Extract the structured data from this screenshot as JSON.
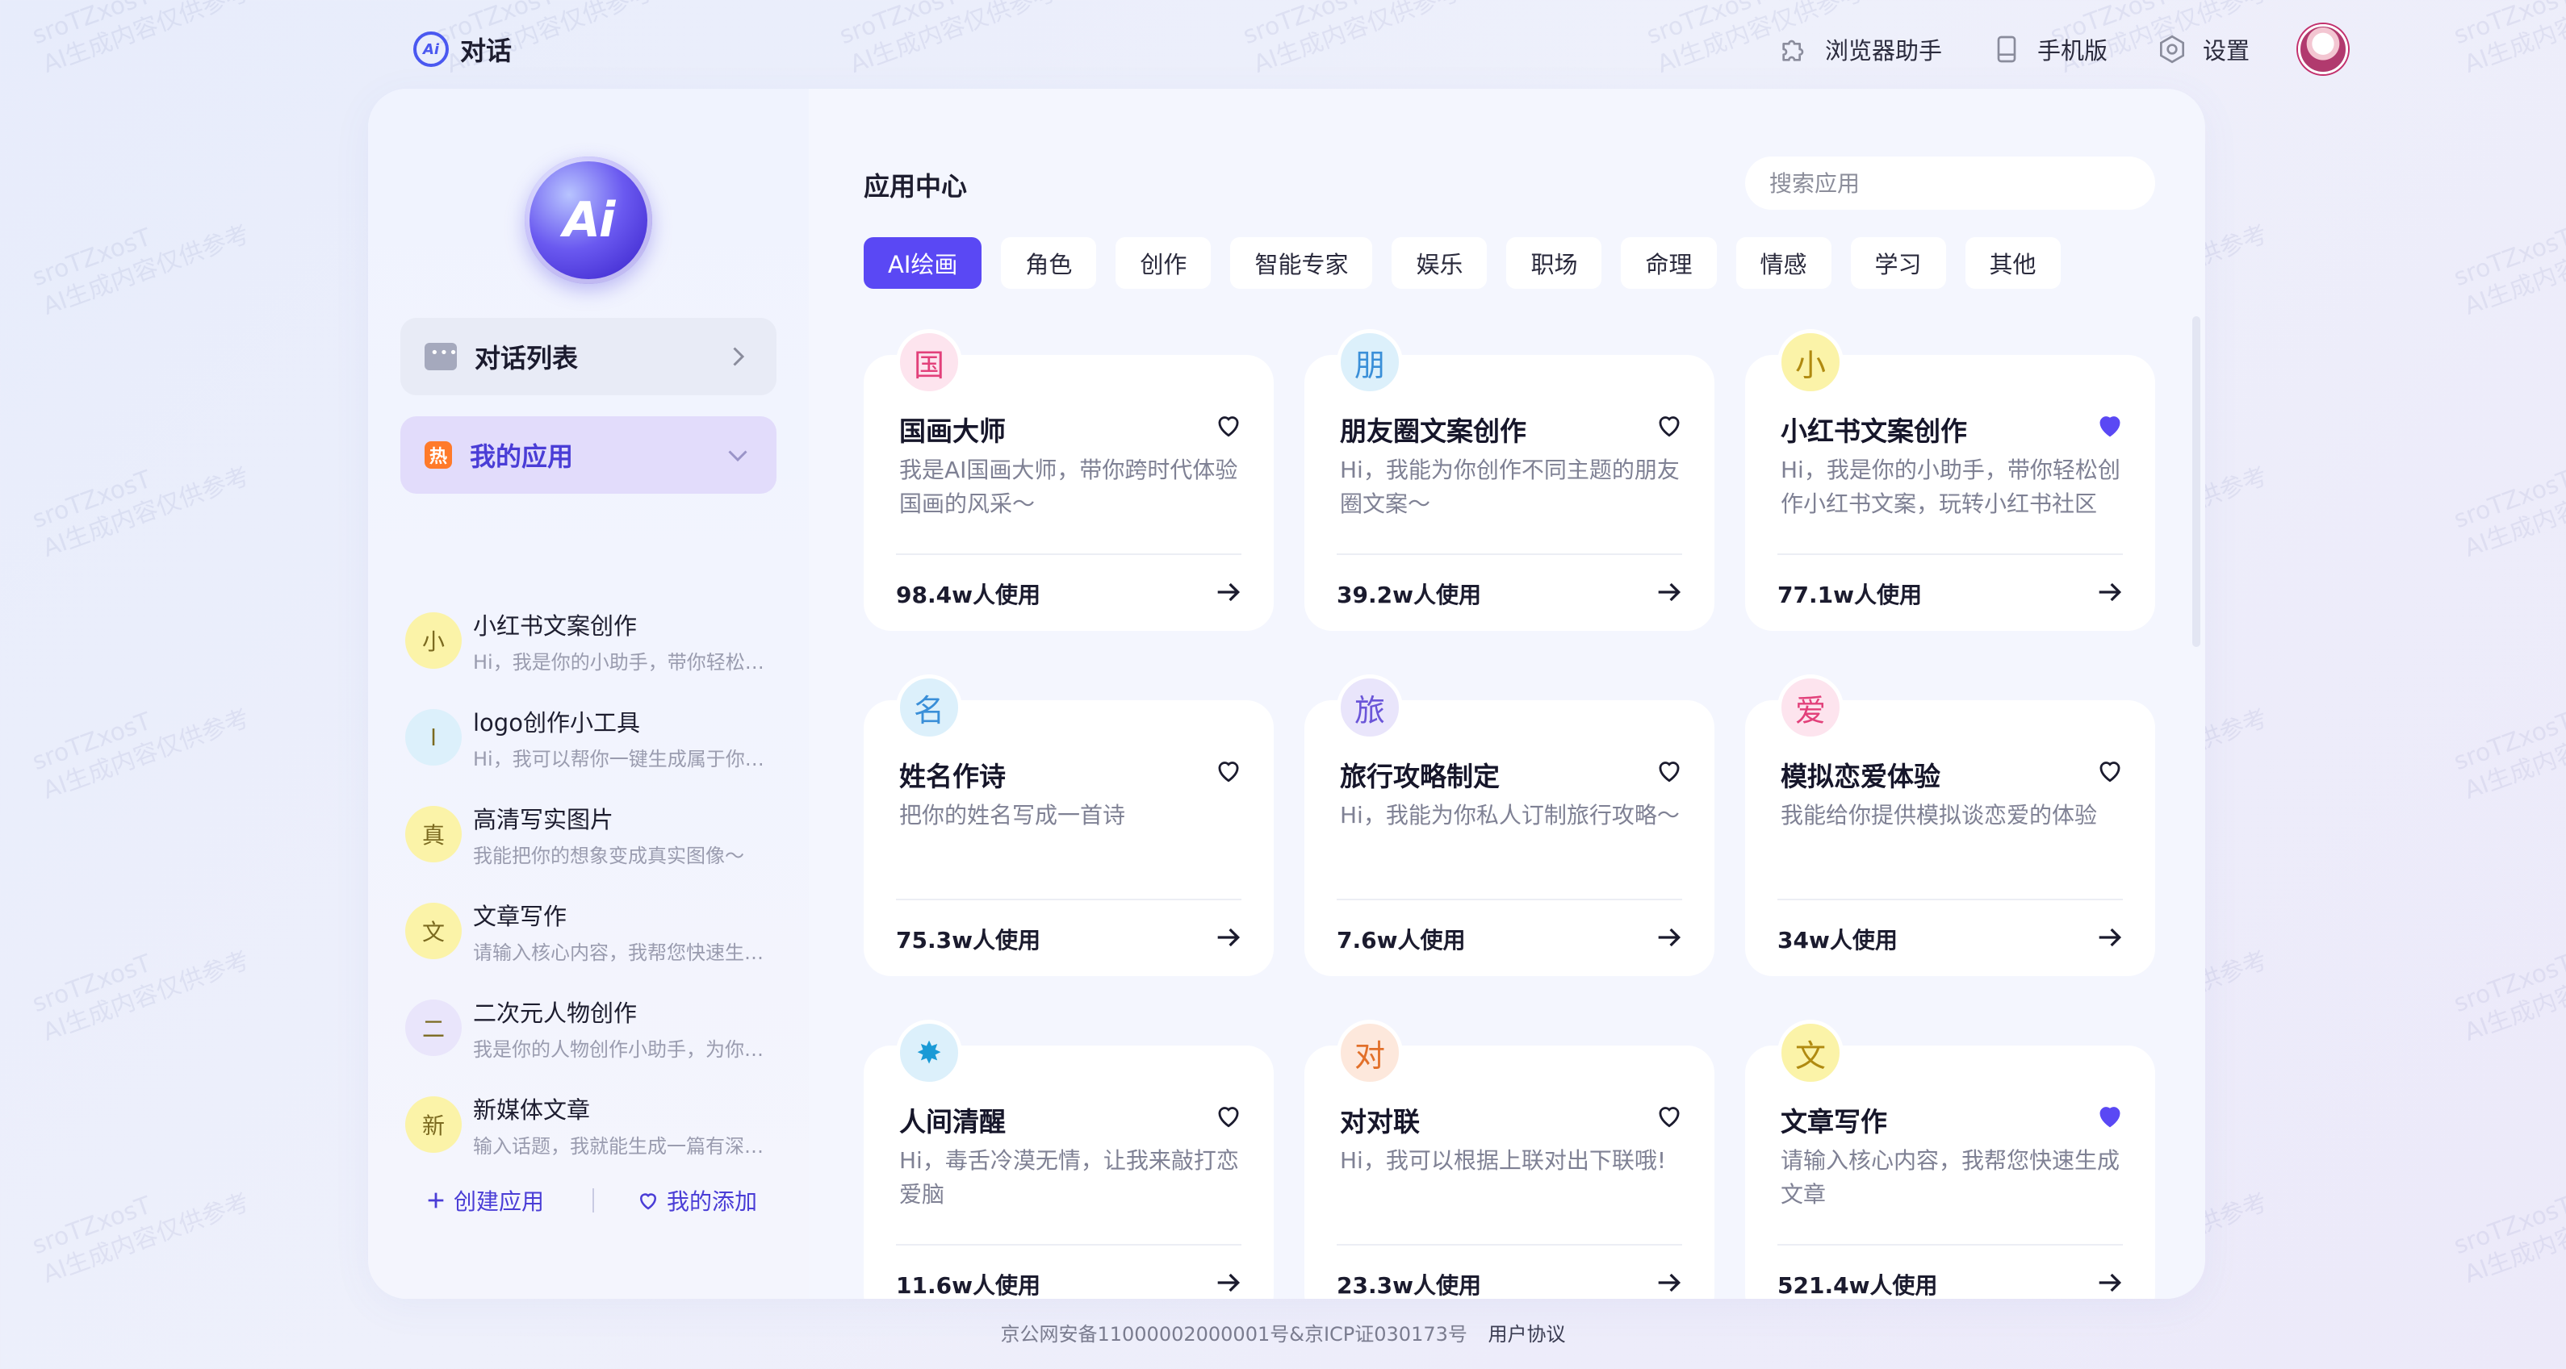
{
  "brand": {
    "title": "对话",
    "badge": "Ai"
  },
  "top_actions": [
    {
      "label": "浏览器助手",
      "icon": "puzzle-icon"
    },
    {
      "label": "手机版",
      "icon": "phone-icon"
    },
    {
      "label": "设置",
      "icon": "gear-icon"
    }
  ],
  "sidebar": {
    "logo": "Ai",
    "conversation_list": "对话列表",
    "my_apps": {
      "badge": "热",
      "label": "我的应用"
    },
    "apps": [
      {
        "avatar": "小",
        "title": "小红书文案创作",
        "desc": "Hi，我是你的小助手，带你轻松创作小红书文案",
        "color": "#fbf3a8"
      },
      {
        "avatar": "l",
        "title": "logo创作小工具",
        "desc": "Hi，我可以帮你一键生成属于你的logo",
        "color": "#dcf0fb"
      },
      {
        "avatar": "真",
        "title": "高清写实图片",
        "desc": "我能把你的想象变成真实图像～",
        "color": "#fbf3a8"
      },
      {
        "avatar": "文",
        "title": "文章写作",
        "desc": "请输入核心内容，我帮您快速生成文章",
        "color": "#fbf3a8"
      },
      {
        "avatar": "二",
        "title": "二次元人物创作",
        "desc": "我是你的人物创作小助手，为你生成二次元人物",
        "color": "#e9e5fb"
      },
      {
        "avatar": "新",
        "title": "新媒体文章",
        "desc": "输入话题，我就能生成一篇有深度的新媒体文章",
        "color": "#fbf3a8"
      }
    ],
    "create_app": "创建应用",
    "my_favorites": "我的添加"
  },
  "content": {
    "title": "应用中心",
    "search_placeholder": "搜索应用",
    "tabs": [
      "AI绘画",
      "角色",
      "创作",
      "智能专家",
      "娱乐",
      "职场",
      "命理",
      "情感",
      "学习",
      "其他"
    ],
    "active_tab": 0,
    "cards": [
      {
        "badge": "国",
        "badge_bg": "#fde4ee",
        "badge_color": "#e2407a",
        "name": "国画大师",
        "desc": "我是AI国画大师，带你跨时代体验国画的风采～",
        "uses": "98.4w人使用",
        "favorited": false
      },
      {
        "badge": "朋",
        "badge_bg": "#dcf0fb",
        "badge_color": "#3a8fd8",
        "name": "朋友圈文案创作",
        "desc": "Hi，我能为你创作不同主题的朋友圈文案～",
        "uses": "39.2w人使用",
        "favorited": false
      },
      {
        "badge": "小",
        "badge_bg": "#fbf3a8",
        "badge_color": "#b08a10",
        "name": "小红书文案创作",
        "desc": "Hi，我是你的小助手，带你轻松创作小红书文案，玩转小红书社区",
        "uses": "77.1w人使用",
        "favorited": true
      },
      {
        "badge": "名",
        "badge_bg": "#dcf0fb",
        "badge_color": "#3a8fd8",
        "name": "姓名作诗",
        "desc": "把你的姓名写成一首诗",
        "uses": "75.3w人使用",
        "favorited": false
      },
      {
        "badge": "旅",
        "badge_bg": "#e9e5fb",
        "badge_color": "#6a55d8",
        "name": "旅行攻略制定",
        "desc": "Hi，我能为你私人订制旅行攻略～",
        "uses": "7.6w人使用",
        "favorited": false
      },
      {
        "badge": "爱",
        "badge_bg": "#fde4ee",
        "badge_color": "#e2407a",
        "name": "模拟恋爱体验",
        "desc": "我能给你提供模拟谈恋爱的体验",
        "uses": "34w人使用",
        "favorited": false
      },
      {
        "badge": "✸",
        "badge_bg": "#dcf0fb",
        "badge_color": "#1a9ad6",
        "name": "人间清醒",
        "desc": "Hi，毒舌冷漠无情，让我来敲打恋爱脑",
        "uses": "11.6w人使用",
        "favorited": false
      },
      {
        "badge": "对",
        "badge_bg": "#fde8dc",
        "badge_color": "#e2702a",
        "name": "对对联",
        "desc": "Hi，我可以根据上联对出下联哦!",
        "uses": "23.3w人使用",
        "favorited": false
      },
      {
        "badge": "文",
        "badge_bg": "#fbf3a8",
        "badge_color": "#b08a10",
        "name": "文章写作",
        "desc": "请输入核心内容，我帮您快速生成文章",
        "uses": "521.4w人使用",
        "favorited": true
      }
    ]
  },
  "footer": {
    "icp": "京公网安备11000002000001号&京ICP证030173号",
    "agreement": "用户协议"
  },
  "watermark": {
    "line1": "sroTZxosT",
    "line2": "AI生成内容仅供参考"
  },
  "colors": {
    "accent": "#5a48f4",
    "heart_filled": "#5a48f4"
  }
}
